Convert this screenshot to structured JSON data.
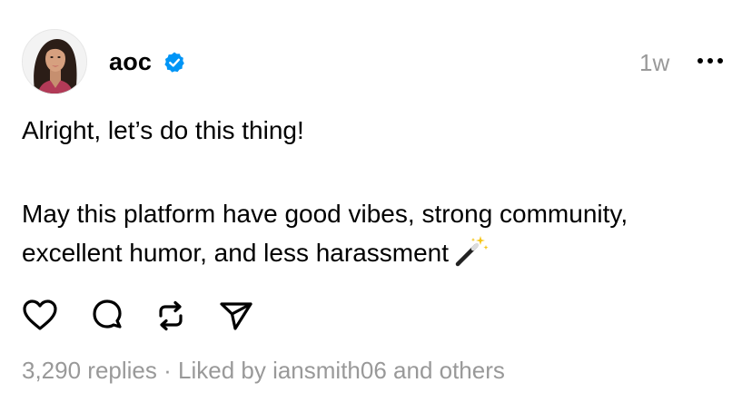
{
  "post": {
    "username": "aoc",
    "time_ago": "1w",
    "lines": [
      "Alright, let’s do this thing!",
      "May this platform have good vibes, strong community,",
      "excellent humor, and less harassment"
    ],
    "emoji": "magic-wand",
    "replies": "3,290 replies",
    "separator": " · ",
    "liked_by": "Liked by iansmith06 and others"
  },
  "icons": {
    "verified": "verified-badge-icon",
    "more": "more-dots-icon",
    "actions": [
      "heart-icon",
      "comment-icon",
      "repost-icon",
      "share-icon"
    ]
  },
  "colors": {
    "verified_blue": "#0095F6",
    "secondary_text": "#999999",
    "text": "#000000",
    "background": "#FFFFFF"
  }
}
